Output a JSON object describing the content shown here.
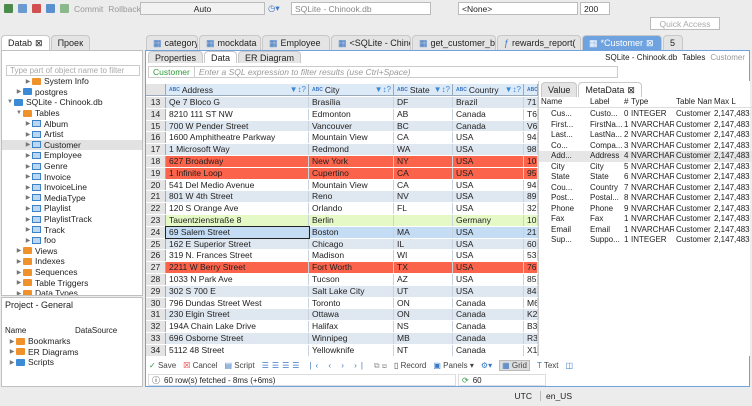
{
  "toolbar": {
    "commit": "Commit",
    "rollback": "Rollback",
    "mode": "Auto",
    "datasource": "SQLite - Chinook.db",
    "schema": "<None>",
    "limit": "200",
    "quick_access": "Quick Access"
  },
  "left_tabs": [
    "Datab",
    "Проек"
  ],
  "navigator": {
    "filter_placeholder": "Type part of object name to filter",
    "items": [
      {
        "label": "System Info",
        "level": 2,
        "icon": "folder",
        "expanded": false
      },
      {
        "label": "postgres",
        "level": 1,
        "icon": "database",
        "expanded": false
      },
      {
        "label": "SQLite - Chinook.db",
        "level": 0,
        "icon": "database",
        "expanded": true
      },
      {
        "label": "Tables",
        "level": 1,
        "icon": "tables",
        "expanded": true
      },
      {
        "label": "Album",
        "level": 2,
        "icon": "table"
      },
      {
        "label": "Artist",
        "level": 2,
        "icon": "table"
      },
      {
        "label": "Customer",
        "level": 2,
        "icon": "table",
        "selected": true
      },
      {
        "label": "Employee",
        "level": 2,
        "icon": "table"
      },
      {
        "label": "Genre",
        "level": 2,
        "icon": "table"
      },
      {
        "label": "Invoice",
        "level": 2,
        "icon": "table"
      },
      {
        "label": "InvoiceLine",
        "level": 2,
        "icon": "table"
      },
      {
        "label": "MediaType",
        "level": 2,
        "icon": "table"
      },
      {
        "label": "Playlist",
        "level": 2,
        "icon": "table"
      },
      {
        "label": "PlaylistTrack",
        "level": 2,
        "icon": "table"
      },
      {
        "label": "Track",
        "level": 2,
        "icon": "table"
      },
      {
        "label": "foo",
        "level": 2,
        "icon": "table"
      },
      {
        "label": "Views",
        "level": 1,
        "icon": "folder"
      },
      {
        "label": "Indexes",
        "level": 1,
        "icon": "folder"
      },
      {
        "label": "Sequences",
        "level": 1,
        "icon": "folder"
      },
      {
        "label": "Table Triggers",
        "level": 1,
        "icon": "folder"
      },
      {
        "label": "Data Types",
        "level": 1,
        "icon": "folder"
      }
    ]
  },
  "project": {
    "title": "Project - General",
    "columns": [
      "Name",
      "DataSource"
    ],
    "items": [
      "Bookmarks",
      "ER Diagrams",
      "Scripts"
    ]
  },
  "editor_tabs": [
    "category",
    "mockdata",
    "Employee",
    "<SQLite - Chino",
    "get_customer_ba",
    "rewards_report(",
    "*Customer",
    "5"
  ],
  "sub_tabs": [
    "Properties",
    "Data",
    "ER Diagram"
  ],
  "breadcrumb": {
    "datasource": "SQLite - Chinook.db",
    "tables": "Tables",
    "table": "Customer"
  },
  "filter": {
    "table": "Customer",
    "placeholder": "Enter a SQL expression to filter results (use Ctrl+Space)"
  },
  "grid": {
    "columns": [
      "Address",
      "City",
      "State",
      "Country"
    ],
    "rows": [
      [
        "13",
        "Qe 7 Bloco G",
        "Brasília",
        "DF",
        "Brazil",
        "71",
        ""
      ],
      [
        "14",
        "8210 111 ST NW",
        "Edmonton",
        "AB",
        "Canada",
        "T6",
        ""
      ],
      [
        "15",
        "700 W Pender Street",
        "Vancouver",
        "BC",
        "Canada",
        "V6",
        ""
      ],
      [
        "16",
        "1600 Amphitheatre Parkway",
        "Mountain View",
        "CA",
        "USA",
        "94",
        ""
      ],
      [
        "17",
        "1 Microsoft Way",
        "Redmond",
        "WA",
        "USA",
        "98",
        ""
      ],
      [
        "18",
        "627 Broadway",
        "New York",
        "NY",
        "USA",
        "10",
        "red"
      ],
      [
        "19",
        "1 Infinite Loop",
        "Cupertino",
        "CA",
        "USA",
        "95",
        "red"
      ],
      [
        "20",
        "541 Del Medio Avenue",
        "Mountain View",
        "CA",
        "USA",
        "94",
        ""
      ],
      [
        "21",
        "801 W 4th Street",
        "Reno",
        "NV",
        "USA",
        "89",
        ""
      ],
      [
        "22",
        "120 S Orange Ave",
        "Orlando",
        "FL",
        "USA",
        "32",
        ""
      ],
      [
        "23",
        "Tauentzienstraße 8",
        "Berlin",
        "",
        "Germany",
        "10",
        "green"
      ],
      [
        "24",
        "69 Salem Street",
        "Boston",
        "MA",
        "USA",
        "21",
        "selected"
      ],
      [
        "25",
        "162 E Superior Street",
        "Chicago",
        "IL",
        "USA",
        "60",
        ""
      ],
      [
        "26",
        "319 N. Frances Street",
        "Madison",
        "WI",
        "USA",
        "53",
        ""
      ],
      [
        "27",
        "2211 W Berry Street",
        "Fort Worth",
        "TX",
        "USA",
        "76",
        "red"
      ],
      [
        "28",
        "1033 N Park Ave",
        "Tucson",
        "AZ",
        "USA",
        "85",
        ""
      ],
      [
        "29",
        "302 S 700 E",
        "Salt Lake City",
        "UT",
        "USA",
        "84",
        ""
      ],
      [
        "30",
        "796 Dundas Street West",
        "Toronto",
        "ON",
        "Canada",
        "M6",
        ""
      ],
      [
        "31",
        "230 Elgin Street",
        "Ottawa",
        "ON",
        "Canada",
        "K2",
        ""
      ],
      [
        "32",
        "194A Chain Lake Drive",
        "Halifax",
        "NS",
        "Canada",
        "B3",
        ""
      ],
      [
        "33",
        "696 Osborne Street",
        "Winnipeg",
        "MB",
        "Canada",
        "R3",
        ""
      ],
      [
        "34",
        "5112 48 Street",
        "Yellowknife",
        "NT",
        "Canada",
        "X1",
        ""
      ]
    ]
  },
  "side_tabs": [
    "Value",
    "MetaData"
  ],
  "metadata": {
    "columns": [
      "Name",
      "Label",
      "#",
      "Type",
      "Table Name",
      "Max L"
    ],
    "rows": [
      [
        "Cus...",
        "Custo...",
        "0",
        "INTEGER",
        "Customer",
        "2,147,483"
      ],
      [
        "First...",
        "FirstNa...",
        "1",
        "NVARCHAR",
        "Customer",
        "2,147,483"
      ],
      [
        "Last...",
        "LastNa...",
        "2",
        "NVARCHAR",
        "Customer",
        "2,147,483"
      ],
      [
        "Co...",
        "Compa...",
        "3",
        "NVARCHAR",
        "Customer",
        "2,147,483"
      ],
      [
        "Add...",
        "Address",
        "4",
        "NVARCHAR",
        "Customer",
        "2,147,483"
      ],
      [
        "City",
        "City",
        "5",
        "NVARCHAR",
        "Customer",
        "2,147,483"
      ],
      [
        "State",
        "State",
        "6",
        "NVARCHAR",
        "Customer",
        "2,147,483"
      ],
      [
        "Cou...",
        "Country",
        "7",
        "NVARCHAR",
        "Customer",
        "2,147,483"
      ],
      [
        "Post...",
        "Postal...",
        "8",
        "NVARCHAR",
        "Customer",
        "2,147,483"
      ],
      [
        "Phone",
        "Phone",
        "9",
        "NVARCHAR",
        "Customer",
        "2,147,483"
      ],
      [
        "Fax",
        "Fax",
        "1",
        "NVARCHAR",
        "Customer",
        "2,147,483"
      ],
      [
        "Email",
        "Email",
        "1",
        "NVARCHAR",
        "Customer",
        "2,147,483"
      ],
      [
        "Sup...",
        "Suppo...",
        "1",
        "INTEGER",
        "Customer",
        "2,147,483"
      ]
    ]
  },
  "bottom_toolbar": {
    "save": "Save",
    "cancel": "Cancel",
    "script": "Script",
    "record": "Record",
    "panels": "Panels",
    "grid": "Grid",
    "text": "Text"
  },
  "status": {
    "message": "60 row(s) fetched - 8ms (+6ms)",
    "count": "60"
  },
  "statusbar": {
    "timezone": "UTC",
    "locale": "en_US"
  },
  "colors": {
    "red_row": "#fc634b",
    "green_row": "#e5f9c6",
    "selected_row": "#c5dcf5",
    "alt_row": "#dfe7f0",
    "accent": "#3a8ad6"
  }
}
